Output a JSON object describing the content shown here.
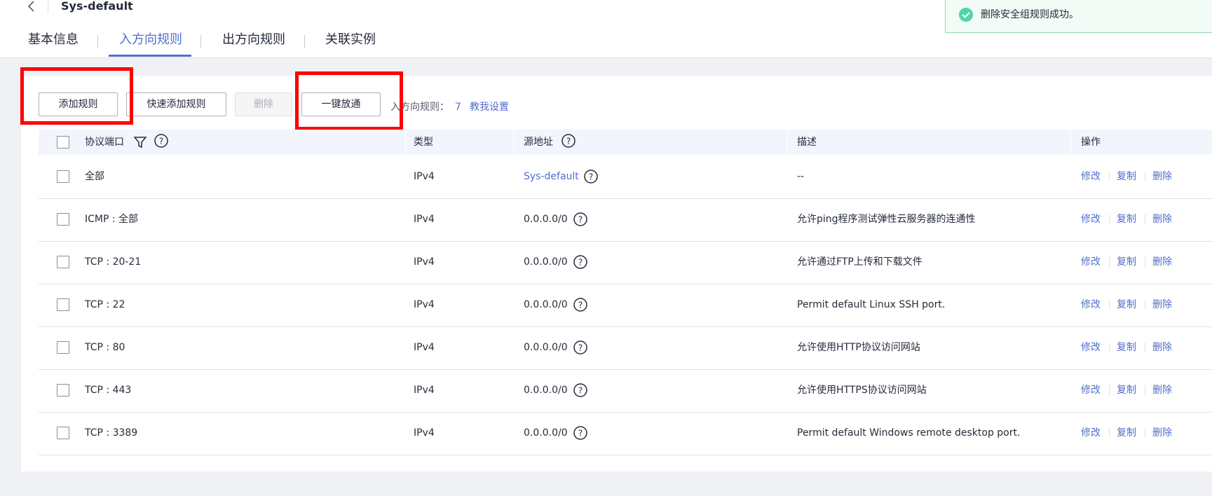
{
  "header": {
    "title": "Sys-default",
    "tabs": [
      {
        "label": "基本信息"
      },
      {
        "label": "入方向规则"
      },
      {
        "label": "出方向规则"
      },
      {
        "label": "关联实例"
      }
    ]
  },
  "toast": {
    "message": "删除安全组规则成功。"
  },
  "toolbar": {
    "add_rule": "添加规则",
    "quick_add_rule": "快速添加规则",
    "delete": "删除",
    "one_click_allow": "一键放通",
    "rule_count_label": "入方向规则：",
    "rule_count": "7",
    "help_link": "教我设置"
  },
  "table": {
    "columns": {
      "protocol_port": "协议端口",
      "type": "类型",
      "source": "源地址",
      "description": "描述",
      "actions": "操作"
    },
    "actions": {
      "edit": "修改",
      "copy": "复制",
      "delete": "删除"
    },
    "rows": [
      {
        "protocol_port": "全部",
        "type": "IPv4",
        "source": "Sys-default",
        "description": "--"
      },
      {
        "protocol_port": "ICMP : 全部",
        "type": "IPv4",
        "source": "0.0.0.0/0",
        "description": "允许ping程序测试弹性云服务器的连通性"
      },
      {
        "protocol_port": "TCP : 20-21",
        "type": "IPv4",
        "source": "0.0.0.0/0",
        "description": "允许通过FTP上传和下载文件"
      },
      {
        "protocol_port": "TCP : 22",
        "type": "IPv4",
        "source": "0.0.0.0/0",
        "description": "Permit default Linux SSH port."
      },
      {
        "protocol_port": "TCP : 80",
        "type": "IPv4",
        "source": "0.0.0.0/0",
        "description": "允许使用HTTP协议访问网站"
      },
      {
        "protocol_port": "TCP : 443",
        "type": "IPv4",
        "source": "0.0.0.0/0",
        "description": "允许使用HTTPS协议访问网站"
      },
      {
        "protocol_port": "TCP : 3389",
        "type": "IPv4",
        "source": "0.0.0.0/0",
        "description": "Permit default Windows remote desktop port."
      }
    ]
  },
  "colors": {
    "accent": "#526ecc",
    "success": "#50d4ab",
    "highlight_box": "#ff0000"
  },
  "icons": [
    "back-arrow-icon",
    "success-check-icon",
    "filter-icon",
    "help-circle-icon"
  ]
}
